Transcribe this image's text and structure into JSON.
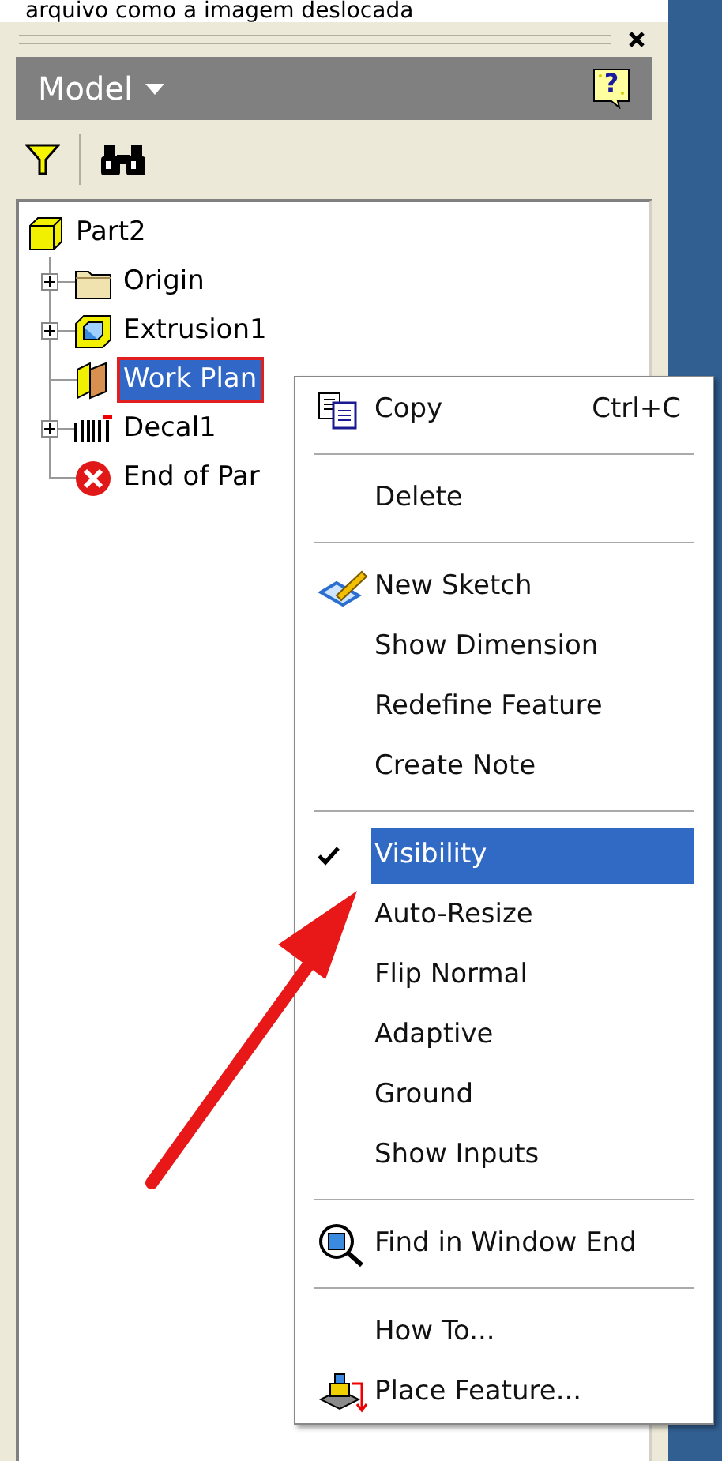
{
  "caption": "arquivo como a imagem deslocada",
  "panel": {
    "title": "Model",
    "help": "?"
  },
  "tree": [
    {
      "label": "Part2",
      "selected": false,
      "children": [
        {
          "label": "Origin",
          "expandable": true,
          "selected": false
        },
        {
          "label": "Extrusion1",
          "expandable": true,
          "selected": false
        },
        {
          "label": "Work Plan",
          "expandable": false,
          "selected": true
        },
        {
          "label": "Decal1",
          "expandable": true,
          "selected": false
        },
        {
          "label": "End of Par",
          "expandable": false,
          "selected": false
        }
      ]
    }
  ],
  "context_menu": [
    {
      "kind": "item",
      "label": "Copy",
      "shortcut": "Ctrl+C",
      "checked": false,
      "selected": false
    },
    {
      "kind": "separator"
    },
    {
      "kind": "item",
      "label": "Delete",
      "checked": false,
      "selected": false
    },
    {
      "kind": "separator"
    },
    {
      "kind": "item",
      "label": "New Sketch",
      "checked": false,
      "selected": false
    },
    {
      "kind": "item",
      "label": "Show Dimension",
      "checked": false,
      "selected": false
    },
    {
      "kind": "item",
      "label": "Redefine Feature",
      "checked": false,
      "selected": false
    },
    {
      "kind": "item",
      "label": "Create Note",
      "checked": false,
      "selected": false
    },
    {
      "kind": "separator"
    },
    {
      "kind": "item",
      "label": "Visibility",
      "checked": true,
      "selected": true
    },
    {
      "kind": "item",
      "label": "Auto-Resize",
      "checked": false,
      "selected": false
    },
    {
      "kind": "item",
      "label": "Flip Normal",
      "checked": false,
      "selected": false
    },
    {
      "kind": "item",
      "label": "Adaptive",
      "checked": false,
      "selected": false
    },
    {
      "kind": "item",
      "label": "Ground",
      "checked": false,
      "selected": false
    },
    {
      "kind": "item",
      "label": "Show Inputs",
      "checked": false,
      "selected": false
    },
    {
      "kind": "separator"
    },
    {
      "kind": "item",
      "label": "Find in Window End",
      "checked": false,
      "selected": false
    },
    {
      "kind": "separator"
    },
    {
      "kind": "item",
      "label": "How To...",
      "checked": false,
      "selected": false
    },
    {
      "kind": "item",
      "label": "Place Feature...",
      "checked": false,
      "selected": false
    }
  ]
}
